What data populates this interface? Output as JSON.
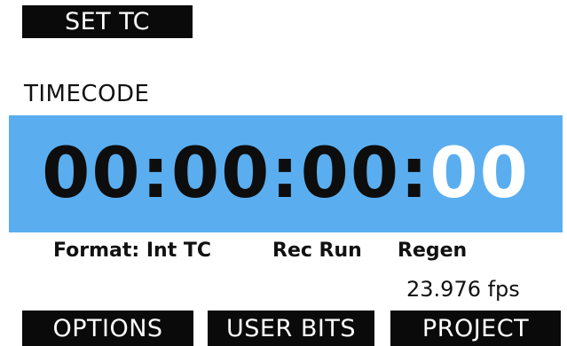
{
  "top_softkey": {
    "label": "SET TC"
  },
  "section": {
    "title": "TIMECODE"
  },
  "timecode": {
    "hours": "00",
    "minutes": "00",
    "seconds": "00",
    "frames": "00",
    "separator": ":"
  },
  "status": {
    "format": "Format: Int TC",
    "mode": "Rec Run",
    "regen": "Regen",
    "framerate": "23.976 fps"
  },
  "bottom_softkeys": {
    "options": "OPTIONS",
    "user_bits": "USER BITS",
    "project": "PROJECT"
  },
  "colors": {
    "panel": "#5aaeef",
    "softkey_bg": "#0a0a0a",
    "frames_digits": "#ffffff"
  }
}
